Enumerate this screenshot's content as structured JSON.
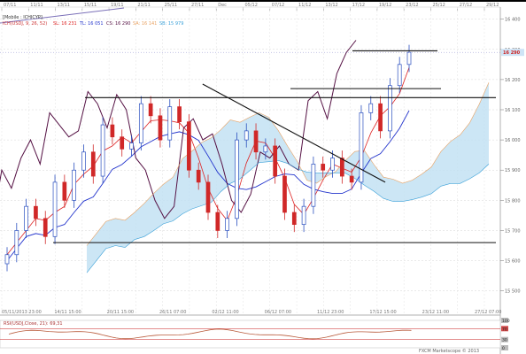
{
  "chart_data": {
    "type": "line",
    "symbol_label": "[Mobile : ICHICYP]",
    "legend": {
      "name": "ICH(USDJ, 9, 26, 52)",
      "items": [
        {
          "label": "SL: 16 231",
          "color": "#dd2222"
        },
        {
          "label": "TL: 16 051",
          "color": "#2233cc"
        },
        {
          "label": "CS: 16 290",
          "color": "#551144"
        },
        {
          "label": "SA: 16 141",
          "color": "#e8a060"
        },
        {
          "label": "SB: 15 979",
          "color": "#3aa0d8"
        }
      ]
    },
    "top_dates": [
      "07/11",
      "11/11",
      "13/11",
      "15/11",
      "19/11",
      "21/11",
      "25/11",
      "27/11",
      "Dec",
      "05/12",
      "07/12",
      "11/12",
      "13/12",
      "17/12",
      "19/12",
      "23/12",
      "25/12",
      "27/12",
      "29/12"
    ],
    "bottom_dates": [
      "05/11/2013 23:00",
      "14/11 15:00",
      "20/11 15:00",
      "26/11 07:00",
      "02/12 11:00",
      "06/12 07:00",
      "11/12 23:00",
      "17/12 15:00",
      "23/12 11:00",
      "27/12 07:00"
    ],
    "y_ticks": [
      15500,
      15600,
      15700,
      15800,
      15900,
      16000,
      16100,
      16200,
      16300,
      16400
    ],
    "y_labels": [
      "15 500",
      "15 600",
      "15 700",
      "15 800",
      "15 900",
      "16 000",
      "16 100",
      "16 200",
      "16 300",
      "16 400"
    ],
    "ylim": [
      15420,
      16440
    ],
    "current_price": {
      "value": 16290,
      "label": "16 290"
    },
    "lines_horizontal": [
      16140,
      15660,
      16170,
      16295
    ],
    "trendline": {
      "from": [
        0.405,
        16185
      ],
      "to": [
        0.77,
        15860
      ]
    },
    "candles_close": [
      15620,
      15700,
      15780,
      15740,
      15680,
      15860,
      15800,
      15900,
      15960,
      15880,
      16050,
      16010,
      15970,
      15990,
      16120,
      16080,
      16000,
      16110,
      16060,
      15900,
      15860,
      15760,
      15700,
      15740,
      16000,
      16030,
      15960,
      15980,
      15880,
      15760,
      15720,
      15780,
      15920,
      15900,
      15940,
      15880,
      15860,
      16090,
      16120,
      16030,
      16180,
      16250,
      16290
    ],
    "series": [
      {
        "name": "Tenkan",
        "color": "#dd2222"
      },
      {
        "name": "Kijun",
        "color": "#2233cc"
      },
      {
        "name": "Chikou",
        "color": "#551144"
      },
      {
        "name": "Senkou A",
        "color": "#e8a060"
      },
      {
        "name": "Senkou B",
        "color": "#3aa0d8"
      }
    ],
    "rsi": {
      "label": "RSI(USDJ,Close, 21): 69,31",
      "ticks": [
        "100",
        "70",
        "30",
        "0"
      ],
      "levels": [
        70,
        30
      ]
    },
    "watermark": "FXCM Marketscope © 2013"
  }
}
